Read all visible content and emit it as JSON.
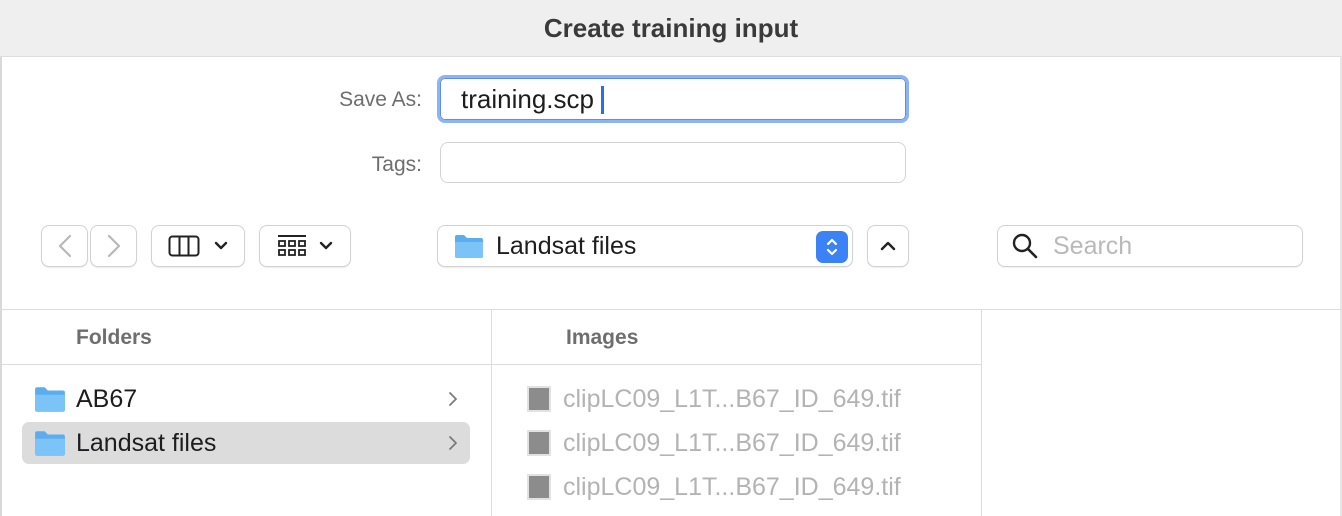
{
  "dialog": {
    "title": "Create training input"
  },
  "save_as": {
    "label": "Save As:",
    "value": "training.scp"
  },
  "tags": {
    "label": "Tags:",
    "value": ""
  },
  "toolbar": {
    "back_icon": "chevron-left-icon",
    "forward_icon": "chevron-right-icon",
    "view_icon": "column-view-icon",
    "group_icon": "group-grid-icon",
    "location": "Landsat files",
    "up_icon": "chevron-up-icon"
  },
  "search": {
    "placeholder": "Search",
    "value": ""
  },
  "browser": {
    "folders_header": "Folders",
    "images_header": "Images",
    "folders": [
      {
        "name": "AB67",
        "selected": false
      },
      {
        "name": "Landsat files",
        "selected": true
      }
    ],
    "images": [
      {
        "name": "clipLC09_L1T...B67_ID_649.tif"
      },
      {
        "name": "clipLC09_L1T...B67_ID_649.tif"
      },
      {
        "name": "clipLC09_L1T...B67_ID_649.tif"
      }
    ]
  },
  "colors": {
    "accent": "#3b82f6",
    "folder": "#5aaef0",
    "selection": "#dcdcdc"
  }
}
